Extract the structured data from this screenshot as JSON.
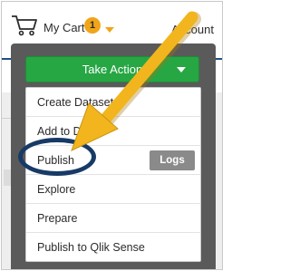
{
  "header": {
    "cart_label": "My Cart",
    "cart_count": "1",
    "account_label": "Account"
  },
  "dropdown": {
    "take_action_label": "Take Action",
    "items": [
      {
        "label": "Create Dataset"
      },
      {
        "label": "Add to Data"
      },
      {
        "label": "Publish"
      },
      {
        "label": "Explore"
      },
      {
        "label": "Prepare"
      },
      {
        "label": "Publish to Qlik Sense"
      }
    ],
    "logs_label": "Logs"
  },
  "colors": {
    "badge": "#f0a519",
    "take_action": "#27a644",
    "highlight_ring": "#173a66",
    "arrow": "#f2b51d"
  },
  "icons": {
    "cart": "shopping-cart-icon",
    "caret": "chevron-down-icon"
  }
}
